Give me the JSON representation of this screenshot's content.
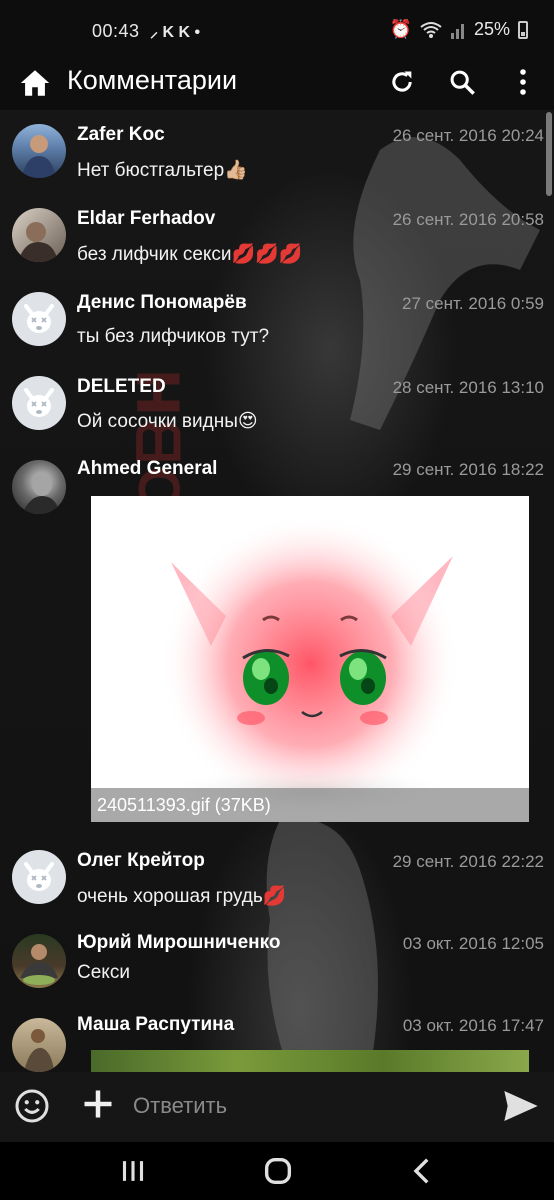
{
  "status_bar": {
    "time": "00:43",
    "left_icons": "⸝ K K •",
    "battery": "25%"
  },
  "toolbar": {
    "title": "Комментарии",
    "icons": [
      "home-icon",
      "refresh-icon",
      "search-icon",
      "more-vert-icon"
    ]
  },
  "comments": [
    {
      "author": "Zafer Koc",
      "date": "26 сент. 2016 20:24",
      "text": "Нет бюстгальтер👍🏼",
      "avatar": "photo"
    },
    {
      "author": "Eldar Ferhadov",
      "date": "26 сент. 2016 20:58",
      "text": "без лифчик секси💋💋💋",
      "avatar": "photo"
    },
    {
      "author": "Денис Пономарёв",
      "date": "27 сент. 2016 0:59",
      "text": "ты без лифчиков тут?",
      "avatar": "deleted-dog"
    },
    {
      "author": "DELETED",
      "date": "28 сент. 2016 13:10",
      "text": "Ой сосочки видны😍",
      "avatar": "deleted-dog"
    },
    {
      "author": "Ahmed General",
      "date": "29 сент. 2016 18:22",
      "text": "",
      "avatar": "photo",
      "attachment": {
        "caption": "240511393.gif (37KB)"
      }
    },
    {
      "author": "Олег Крейтор",
      "date": "29 сент. 2016 22:22",
      "text": "очень хорошая грудь💋",
      "avatar": "deleted-dog"
    },
    {
      "author": "Юрий Мирошниченко",
      "date": "03 окт. 2016 12:05",
      "text": "Секси",
      "avatar": "photo"
    },
    {
      "author": "Маша Распутина",
      "date": "03 окт. 2016 17:47",
      "text": "",
      "avatar": "photo"
    }
  ],
  "input_bar": {
    "placeholder": "Ответить"
  },
  "colors": {
    "background": "#111111",
    "date_text": "#9a9a9a",
    "accent_red": "#c0392b"
  }
}
